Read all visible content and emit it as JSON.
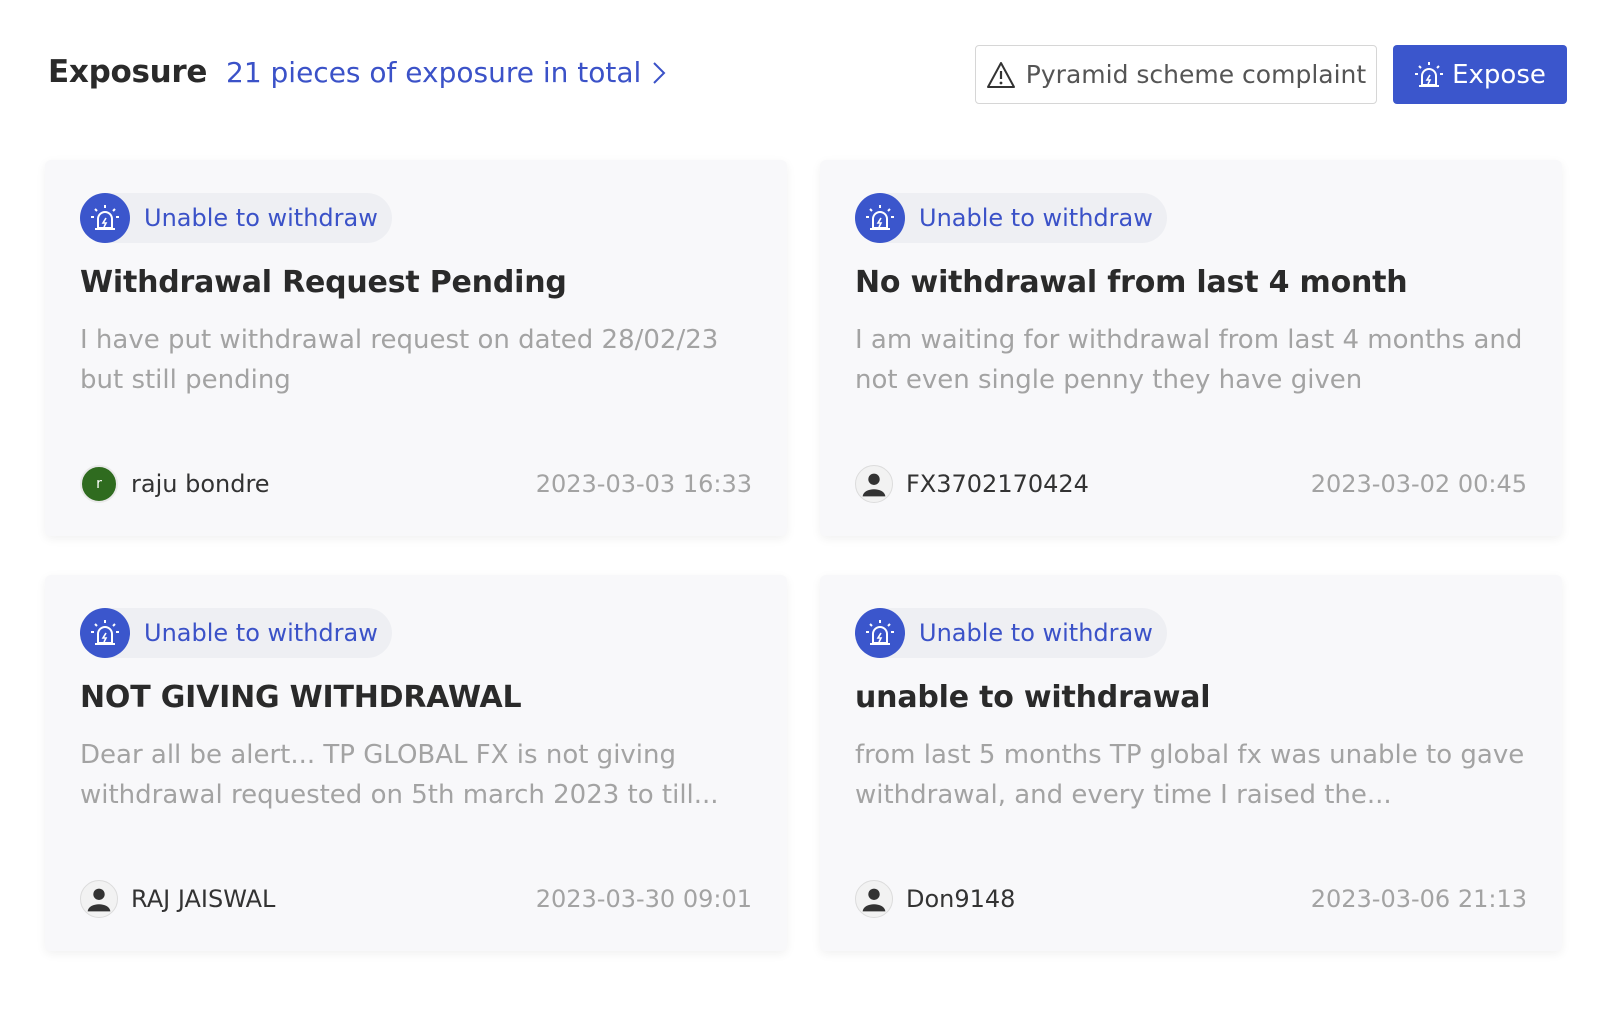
{
  "header": {
    "title": "Exposure",
    "total_link": "21 pieces of exposure in total",
    "complaint_button": "Pyramid scheme complaint",
    "expose_button": "Expose"
  },
  "colors": {
    "accent": "#3b56cc",
    "tag_background": "#eeeff3",
    "card_background": "#f8f8fa",
    "muted_text": "#a3a3a3"
  },
  "cards": [
    {
      "tag": "Unable to withdraw",
      "title": "Withdrawal Request Pending",
      "body": "I have put withdrawal request on dated 28/02/23 but still pending",
      "author": "raju bondre",
      "avatar_letter": "r",
      "date": "2023-03-03 16:33"
    },
    {
      "tag": "Unable to withdraw",
      "title": "No withdrawal from last 4 month",
      "body": "I am waiting for withdrawal from last 4 months and not even single penny they have given",
      "author": "FX3702170424",
      "date": "2023-03-02 00:45"
    },
    {
      "tag": "Unable to withdraw",
      "title": "NOT GIVING WITHDRAWAL",
      "body": "Dear all be alert... TP GLOBAL FX is not giving withdrawal requested on 5th march 2023 to till...",
      "author": "RAJ JAISWAL",
      "date": "2023-03-30 09:01"
    },
    {
      "tag": "Unable to withdraw",
      "title": "unable to withdrawal",
      "body": "from last 5 months TP global fx was unable to gave withdrawal, and every time I raised the...",
      "author": "Don9148",
      "date": "2023-03-06 21:13"
    }
  ]
}
